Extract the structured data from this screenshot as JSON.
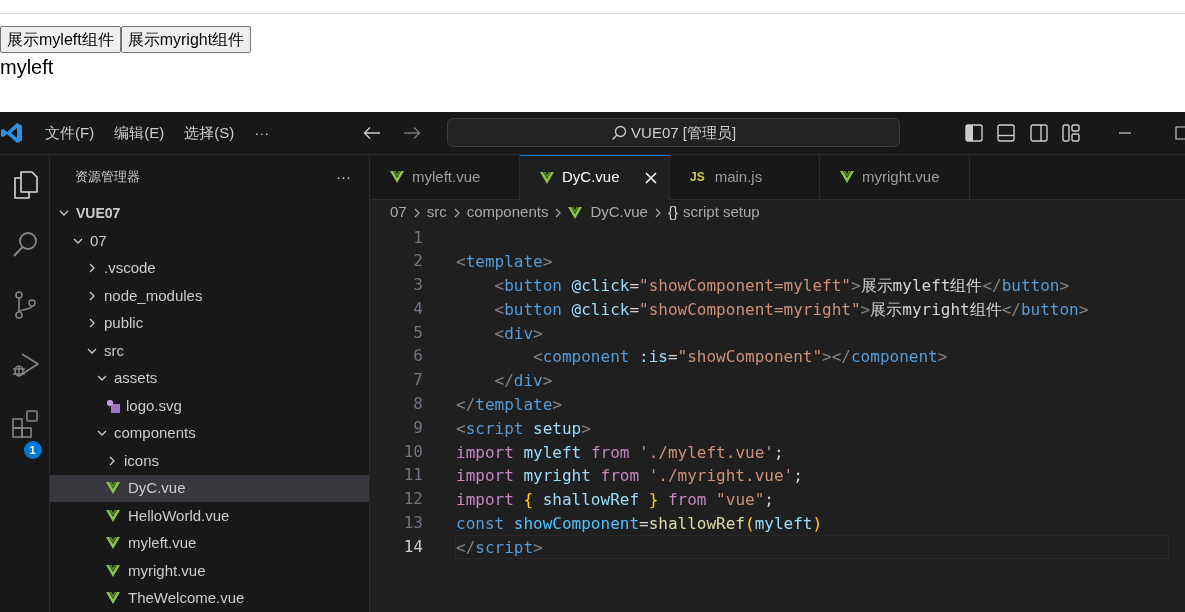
{
  "page": {
    "buttons": [
      "展示myleft组件",
      "展示myright组件"
    ],
    "output": "myleft"
  },
  "vscode": {
    "menu": [
      "文件(F)",
      "编辑(E)",
      "选择(S)"
    ],
    "menu_more": "···",
    "command_center": "VUE07 [管理员]",
    "activity_badge": "1",
    "explorer": {
      "title": "资源管理器",
      "more": "···",
      "tree": [
        {
          "label": "VUE07",
          "kind": "root",
          "expanded": true,
          "selected": false,
          "children": [
            {
              "label": "07",
              "kind": "folder",
              "expanded": true,
              "selected": false,
              "children": [
                {
                  "label": ".vscode",
                  "kind": "folder",
                  "expanded": false,
                  "selected": false
                },
                {
                  "label": "node_modules",
                  "kind": "folder",
                  "expanded": false,
                  "selected": false
                },
                {
                  "label": "public",
                  "kind": "folder",
                  "expanded": false,
                  "selected": false
                },
                {
                  "label": "src",
                  "kind": "folder",
                  "expanded": true,
                  "selected": false,
                  "children": [
                    {
                      "label": "assets",
                      "kind": "folder",
                      "expanded": true,
                      "selected": false,
                      "children": [
                        {
                          "label": "logo.svg",
                          "kind": "svg",
                          "selected": false
                        }
                      ]
                    },
                    {
                      "label": "components",
                      "kind": "folder",
                      "expanded": true,
                      "selected": false,
                      "children": [
                        {
                          "label": "icons",
                          "kind": "folder",
                          "expanded": false,
                          "selected": false
                        },
                        {
                          "label": "DyC.vue",
                          "kind": "vue",
                          "selected": true
                        },
                        {
                          "label": "HelloWorld.vue",
                          "kind": "vue",
                          "selected": false
                        },
                        {
                          "label": "myleft.vue",
                          "kind": "vue",
                          "selected": false
                        },
                        {
                          "label": "myright.vue",
                          "kind": "vue",
                          "selected": false
                        },
                        {
                          "label": "TheWelcome.vue",
                          "kind": "vue",
                          "selected": false
                        }
                      ]
                    }
                  ]
                }
              ]
            }
          ]
        }
      ]
    },
    "tabs": [
      {
        "label": "myleft.vue",
        "kind": "vue",
        "selected": false
      },
      {
        "label": "DyC.vue",
        "kind": "vue",
        "selected": true
      },
      {
        "label": "main.js",
        "kind": "js",
        "badge": "JS",
        "selected": false
      },
      {
        "label": "myright.vue",
        "kind": "vue",
        "selected": false
      }
    ],
    "breadcrumbs": [
      {
        "text": "07",
        "kind": "folder"
      },
      {
        "text": "src",
        "kind": "folder"
      },
      {
        "text": "components",
        "kind": "folder"
      },
      {
        "text": "DyC.vue",
        "kind": "vue"
      },
      {
        "text": "script setup",
        "kind": "symbol",
        "symbol": "{}"
      }
    ],
    "code": [
      {
        "number": "1",
        "current": false
      },
      {
        "number": "2",
        "current": false,
        "tokens": [
          {
            "kind": "punct",
            "text": "<"
          },
          {
            "kind": "tag",
            "text": "template"
          },
          {
            "kind": "punct",
            "text": ">"
          }
        ]
      },
      {
        "number": "3",
        "current": false,
        "tokens": [
          {
            "kind": "punct",
            "text": "    <"
          },
          {
            "kind": "tag",
            "text": "button"
          },
          {
            "kind": "attr",
            "text": " @click"
          },
          {
            "kind": "text",
            "text": "="
          },
          {
            "kind": "str",
            "text": "\"showComponent=myleft\""
          },
          {
            "kind": "punct",
            "text": ">"
          },
          {
            "kind": "text",
            "text": "展示myleft组件"
          },
          {
            "kind": "punct",
            "text": "</"
          },
          {
            "kind": "tag",
            "text": "button"
          },
          {
            "kind": "punct",
            "text": ">"
          }
        ]
      },
      {
        "number": "4",
        "current": false,
        "tokens": [
          {
            "kind": "punct",
            "text": "    <"
          },
          {
            "kind": "tag",
            "text": "button"
          },
          {
            "kind": "attr",
            "text": " @click"
          },
          {
            "kind": "text",
            "text": "="
          },
          {
            "kind": "str",
            "text": "\"showComponent=myright\""
          },
          {
            "kind": "punct",
            "text": ">"
          },
          {
            "kind": "text",
            "text": "展示myright组件"
          },
          {
            "kind": "punct",
            "text": "</"
          },
          {
            "kind": "tag",
            "text": "button"
          },
          {
            "kind": "punct",
            "text": ">"
          }
        ]
      },
      {
        "number": "5",
        "current": false,
        "tokens": [
          {
            "kind": "punct",
            "text": "    <"
          },
          {
            "kind": "tag",
            "text": "div"
          },
          {
            "kind": "punct",
            "text": ">"
          }
        ]
      },
      {
        "number": "6",
        "current": false,
        "tokens": [
          {
            "kind": "punct",
            "text": "        <"
          },
          {
            "kind": "tag",
            "text": "component"
          },
          {
            "kind": "attr",
            "text": " :is"
          },
          {
            "kind": "text",
            "text": "="
          },
          {
            "kind": "str",
            "text": "\"showComponent\""
          },
          {
            "kind": "punct",
            "text": "></"
          },
          {
            "kind": "tag",
            "text": "component"
          },
          {
            "kind": "punct",
            "text": ">"
          }
        ]
      },
      {
        "number": "7",
        "current": false,
        "tokens": [
          {
            "kind": "punct",
            "text": "    </"
          },
          {
            "kind": "tag",
            "text": "div"
          },
          {
            "kind": "punct",
            "text": ">"
          }
        ]
      },
      {
        "number": "8",
        "current": false,
        "tokens": [
          {
            "kind": "punct",
            "text": "</"
          },
          {
            "kind": "tag",
            "text": "template"
          },
          {
            "kind": "punct",
            "text": ">"
          }
        ]
      },
      {
        "number": "9",
        "current": false,
        "tokens": [
          {
            "kind": "punct",
            "text": "<"
          },
          {
            "kind": "tag",
            "text": "script"
          },
          {
            "kind": "attr",
            "text": " setup"
          },
          {
            "kind": "punct",
            "text": ">"
          }
        ]
      },
      {
        "number": "10",
        "current": false,
        "tokens": [
          {
            "kind": "keyword",
            "text": "import "
          },
          {
            "kind": "var",
            "text": "myleft "
          },
          {
            "kind": "keyword",
            "text": "from "
          },
          {
            "kind": "str",
            "text": "'./myleft.vue'"
          },
          {
            "kind": "text",
            "text": ";"
          }
        ]
      },
      {
        "number": "11",
        "current": false,
        "tokens": [
          {
            "kind": "keyword",
            "text": "import "
          },
          {
            "kind": "var",
            "text": "myright "
          },
          {
            "kind": "keyword",
            "text": "from "
          },
          {
            "kind": "str",
            "text": "'./myright.vue'"
          },
          {
            "kind": "text",
            "text": ";"
          }
        ]
      },
      {
        "number": "12",
        "current": false,
        "tokens": [
          {
            "kind": "keyword",
            "text": "import "
          },
          {
            "kind": "brace",
            "text": "{ "
          },
          {
            "kind": "var",
            "text": "shallowRef "
          },
          {
            "kind": "brace",
            "text": "} "
          },
          {
            "kind": "keyword",
            "text": "from "
          },
          {
            "kind": "str",
            "text": "\"vue\""
          },
          {
            "kind": "text",
            "text": ";"
          }
        ]
      },
      {
        "number": "13",
        "current": false,
        "tokens": [
          {
            "kind": "storage",
            "text": "const "
          },
          {
            "kind": "const",
            "text": "showComponent"
          },
          {
            "kind": "text",
            "text": "="
          },
          {
            "kind": "func",
            "text": "shallowRef"
          },
          {
            "kind": "brace",
            "text": "("
          },
          {
            "kind": "var",
            "text": "myleft"
          },
          {
            "kind": "brace",
            "text": ")"
          }
        ]
      },
      {
        "number": "14",
        "current": true,
        "tokens": [
          {
            "kind": "punct",
            "text": "</"
          },
          {
            "kind": "tag",
            "text": "script"
          },
          {
            "kind": "punct",
            "text": ">"
          }
        ]
      }
    ]
  }
}
